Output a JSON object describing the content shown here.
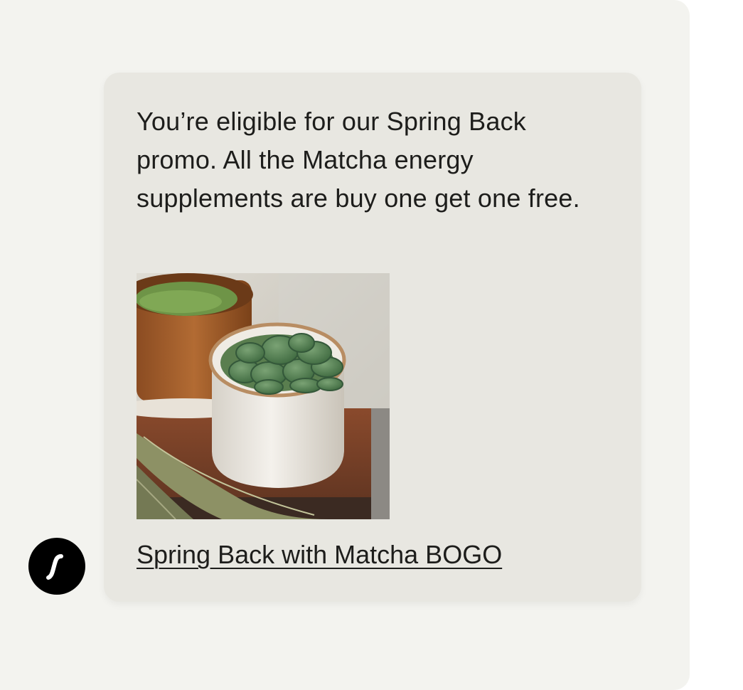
{
  "message": {
    "text": "You’re eligible for our Spring Back promo. All the Matcha energy supplements are buy one get one free.",
    "image_alt": "Matcha energy supplements",
    "link_label": "Spring Back with Matcha BOGO"
  },
  "avatar": {
    "icon": "brand-logo-icon"
  },
  "colors": {
    "page_bg": "#f3f3ef",
    "bubble_bg": "#e8e7e1",
    "text": "#1d1d1b",
    "avatar_bg": "#000000"
  }
}
